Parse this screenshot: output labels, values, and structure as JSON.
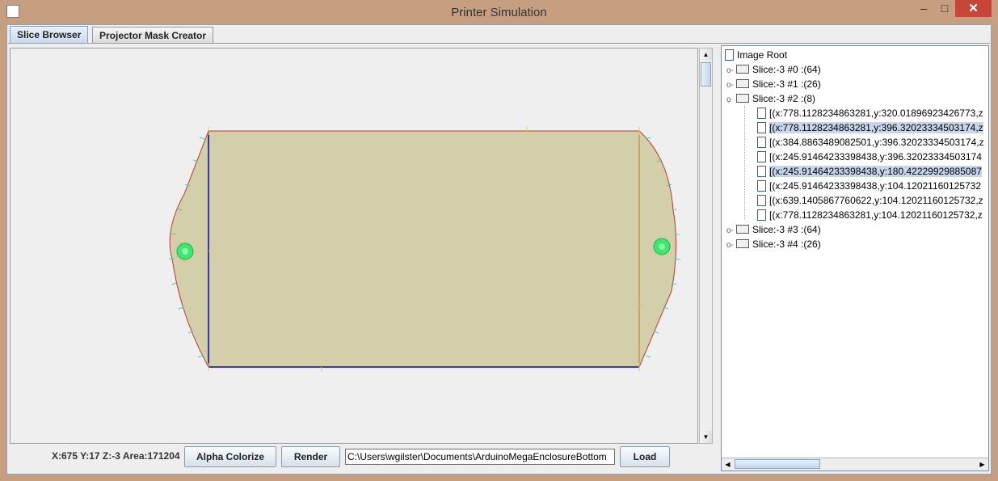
{
  "window": {
    "title": "Printer Simulation",
    "minimize_label": "–",
    "maximize_label": "□",
    "close_label": "✕"
  },
  "tabs": [
    {
      "label": "Slice Browser",
      "active": true
    },
    {
      "label": "Projector Mask Creator",
      "active": false
    }
  ],
  "canvas": {
    "fill_color": "#d3cfab",
    "edge_color": "#c0392b",
    "left_edge_color": "#0000cc",
    "marker_color": "#3ee86e"
  },
  "status": {
    "text": "X:675 Y:17 Z:-3 Area:171204"
  },
  "controls": {
    "alpha_colorize_label": "Alpha Colorize",
    "render_label": "Render",
    "path_value": "C:\\Users\\wgilster\\Documents\\ArduinoMegaEnclosureBottom",
    "load_label": "Load"
  },
  "tree": {
    "root_label": "Image Root",
    "nodes": [
      {
        "label": "Slice:-3 #0 :(64)",
        "expanded": false
      },
      {
        "label": "Slice:-3 #1 :(26)",
        "expanded": false
      },
      {
        "label": "Slice:-3 #2 :(8)",
        "expanded": true
      },
      {
        "label": "[(x:778.1128234863281,y:320.01896923426773,z",
        "selected": false
      },
      {
        "label": "[(x:778.1128234863281,y:396.32023334503174,z",
        "selected": true
      },
      {
        "label": "[(x:384.8863489082501,y:396.32023334503174,z",
        "selected": false
      },
      {
        "label": "[(x:245.91464233398438,y:396.32023334503174",
        "selected": false
      },
      {
        "label": "[(x:245.91464233398438,y:180.42229929885087",
        "selected": true
      },
      {
        "label": "[(x:245.91464233398438,y:104.12021160125732",
        "selected": false
      },
      {
        "label": "[(x:639.1405867760622,y:104.12021160125732,z",
        "selected": false
      },
      {
        "label": "[(x:778.1128234863281,y:104.12021160125732,z",
        "selected": false
      },
      {
        "label": "Slice:-3 #3 :(64)",
        "expanded": false
      },
      {
        "label": "Slice:-3 #4 :(26)",
        "expanded": false
      }
    ]
  }
}
